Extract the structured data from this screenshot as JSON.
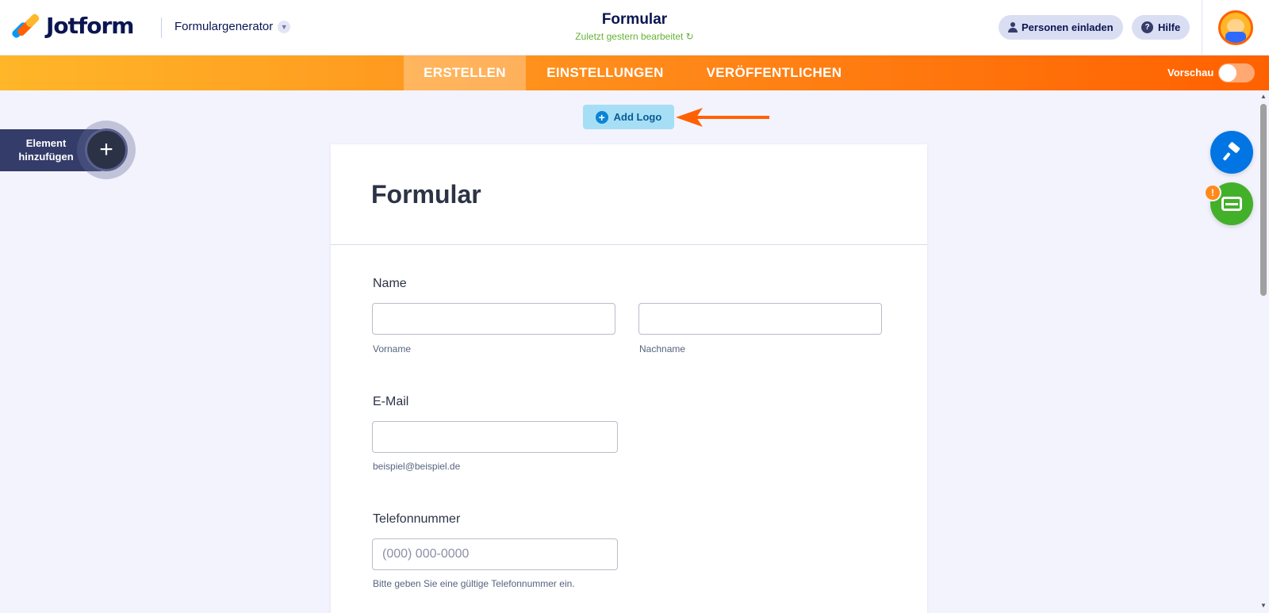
{
  "header": {
    "brand": "Jotform",
    "builder_label": "Formulargenerator",
    "form_title": "Formular",
    "last_edited": "Zuletzt gestern bearbeitet",
    "invite_label": "Personen einladen",
    "help_label": "Hilfe"
  },
  "nav": {
    "tabs": [
      {
        "label": "ERSTELLEN",
        "active": true
      },
      {
        "label": "EINSTELLUNGEN",
        "active": false
      },
      {
        "label": "VERÖFFENTLICHEN",
        "active": false
      }
    ],
    "preview_label": "Vorschau"
  },
  "add_logo_label": "Add Logo",
  "add_element_label": "Element hinzufügen",
  "form": {
    "title": "Formular",
    "fields": {
      "name": {
        "label": "Name",
        "first_sub": "Vorname",
        "last_sub": "Nachname"
      },
      "email": {
        "label": "E-Mail",
        "sub": "beispiel@beispiel.de"
      },
      "phone": {
        "label": "Telefonnummer",
        "placeholder": "(000) 000-0000",
        "sub": "Bitte geben Sie eine gültige Telefonnummer ein."
      }
    }
  },
  "badge_text": "!",
  "colors": {
    "accent_orange": "#ff6100",
    "accent_yellow": "#ffb629",
    "navy": "#0a1551",
    "blue_fab": "#0075e3",
    "green_fab": "#43b02a"
  },
  "icons": [
    "jotform-logo-icon",
    "chevron-down-icon",
    "refresh-icon",
    "person-icon",
    "help-icon",
    "avatar",
    "plus-icon",
    "arrow-icon",
    "paint-roller-icon",
    "card-icon"
  ]
}
